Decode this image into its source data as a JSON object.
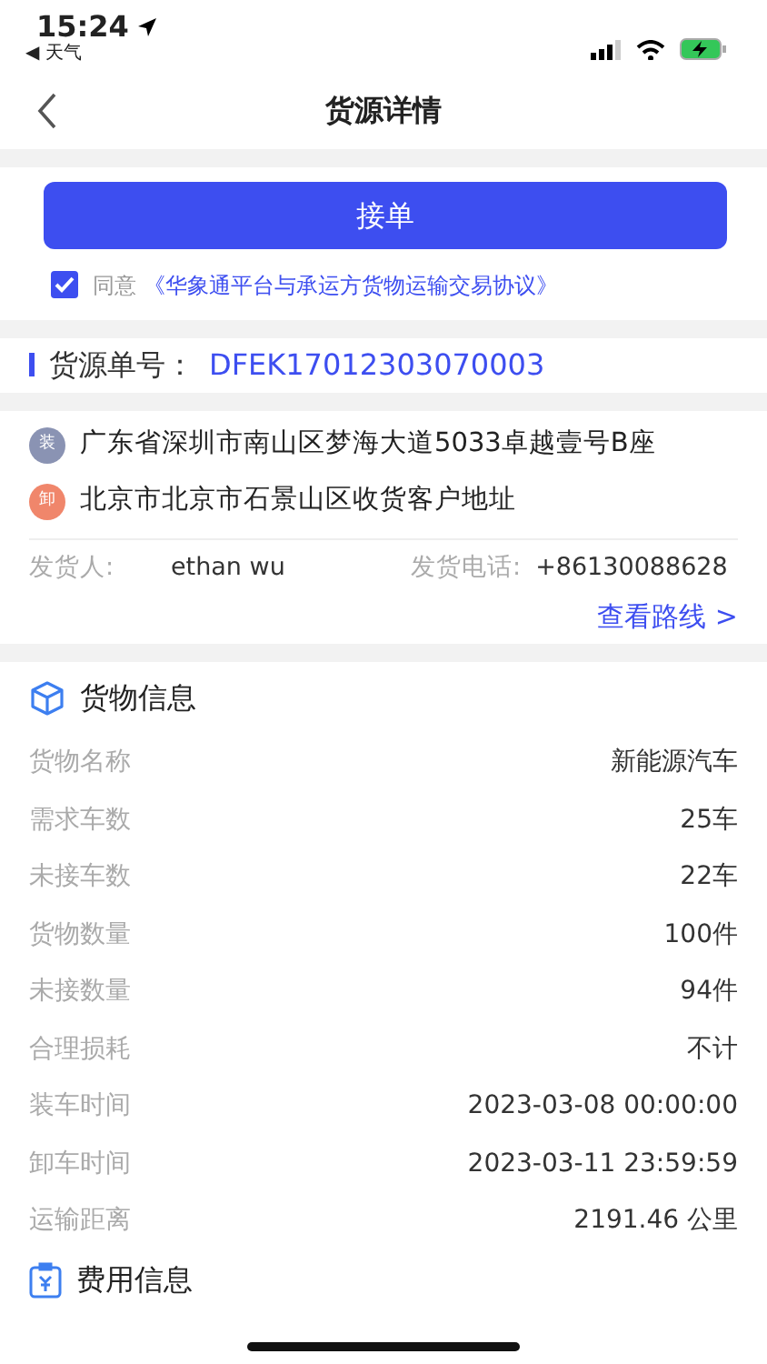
{
  "status_bar": {
    "time": "15:24",
    "back_app": "◀ 天气"
  },
  "nav": {
    "title": "货源详情"
  },
  "accept_button": "接单",
  "agreement": {
    "checked": true,
    "prefix": "同意",
    "link": "《华象通平台与承运方货物运输交易协议》"
  },
  "order": {
    "label": "货源单号：",
    "value": "DFEK17012303070003"
  },
  "addresses": [
    {
      "kind": "load",
      "badge": "装",
      "text": "广东省深圳市南山区梦海大道5033卓越壹号B座"
    },
    {
      "kind": "unload",
      "badge": "卸",
      "text": "北京市北京市石景山区收货客户地址"
    }
  ],
  "shipper": {
    "label": "发货人:",
    "name": "ethan wu",
    "phone_label": "发货电话:",
    "phone": "+86130088628"
  },
  "route_link": "查看路线 >",
  "cargo": {
    "title": "货物信息",
    "rows": [
      {
        "label": "货物名称",
        "value": "新能源汽车"
      },
      {
        "label": "需求车数",
        "value": "25车"
      },
      {
        "label": "未接车数",
        "value": "22车"
      },
      {
        "label": "货物数量",
        "value": "100件"
      },
      {
        "label": "未接数量",
        "value": "94件"
      },
      {
        "label": "合理损耗",
        "value": "不计"
      },
      {
        "label": "装车时间",
        "value": "2023-03-08 00:00:00"
      },
      {
        "label": "卸车时间",
        "value": "2023-03-11 23:59:59"
      },
      {
        "label": "运输距离",
        "value": "2191.46 公里"
      }
    ]
  },
  "fees": {
    "title": "费用信息"
  }
}
